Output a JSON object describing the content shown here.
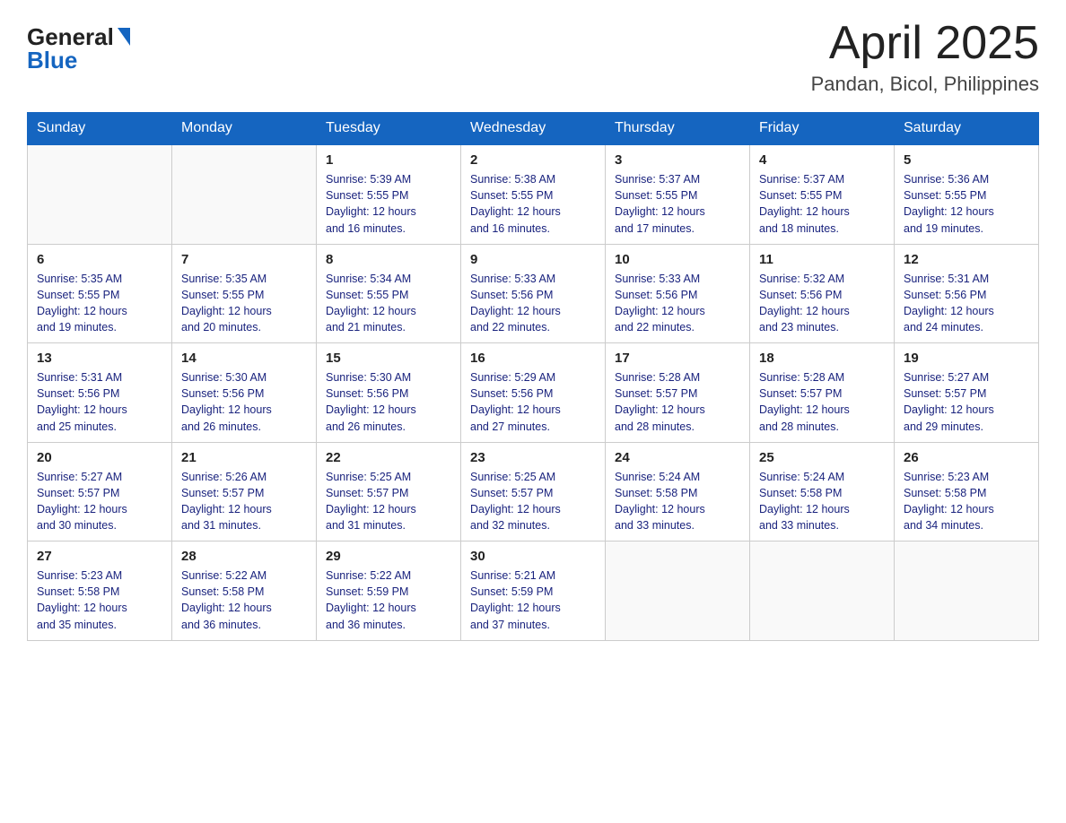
{
  "header": {
    "logo_general": "General",
    "logo_blue": "Blue",
    "month_title": "April 2025",
    "location": "Pandan, Bicol, Philippines"
  },
  "days_of_week": [
    "Sunday",
    "Monday",
    "Tuesday",
    "Wednesday",
    "Thursday",
    "Friday",
    "Saturday"
  ],
  "weeks": [
    [
      {
        "day": "",
        "info": ""
      },
      {
        "day": "",
        "info": ""
      },
      {
        "day": "1",
        "info": "Sunrise: 5:39 AM\nSunset: 5:55 PM\nDaylight: 12 hours\nand 16 minutes."
      },
      {
        "day": "2",
        "info": "Sunrise: 5:38 AM\nSunset: 5:55 PM\nDaylight: 12 hours\nand 16 minutes."
      },
      {
        "day": "3",
        "info": "Sunrise: 5:37 AM\nSunset: 5:55 PM\nDaylight: 12 hours\nand 17 minutes."
      },
      {
        "day": "4",
        "info": "Sunrise: 5:37 AM\nSunset: 5:55 PM\nDaylight: 12 hours\nand 18 minutes."
      },
      {
        "day": "5",
        "info": "Sunrise: 5:36 AM\nSunset: 5:55 PM\nDaylight: 12 hours\nand 19 minutes."
      }
    ],
    [
      {
        "day": "6",
        "info": "Sunrise: 5:35 AM\nSunset: 5:55 PM\nDaylight: 12 hours\nand 19 minutes."
      },
      {
        "day": "7",
        "info": "Sunrise: 5:35 AM\nSunset: 5:55 PM\nDaylight: 12 hours\nand 20 minutes."
      },
      {
        "day": "8",
        "info": "Sunrise: 5:34 AM\nSunset: 5:55 PM\nDaylight: 12 hours\nand 21 minutes."
      },
      {
        "day": "9",
        "info": "Sunrise: 5:33 AM\nSunset: 5:56 PM\nDaylight: 12 hours\nand 22 minutes."
      },
      {
        "day": "10",
        "info": "Sunrise: 5:33 AM\nSunset: 5:56 PM\nDaylight: 12 hours\nand 22 minutes."
      },
      {
        "day": "11",
        "info": "Sunrise: 5:32 AM\nSunset: 5:56 PM\nDaylight: 12 hours\nand 23 minutes."
      },
      {
        "day": "12",
        "info": "Sunrise: 5:31 AM\nSunset: 5:56 PM\nDaylight: 12 hours\nand 24 minutes."
      }
    ],
    [
      {
        "day": "13",
        "info": "Sunrise: 5:31 AM\nSunset: 5:56 PM\nDaylight: 12 hours\nand 25 minutes."
      },
      {
        "day": "14",
        "info": "Sunrise: 5:30 AM\nSunset: 5:56 PM\nDaylight: 12 hours\nand 26 minutes."
      },
      {
        "day": "15",
        "info": "Sunrise: 5:30 AM\nSunset: 5:56 PM\nDaylight: 12 hours\nand 26 minutes."
      },
      {
        "day": "16",
        "info": "Sunrise: 5:29 AM\nSunset: 5:56 PM\nDaylight: 12 hours\nand 27 minutes."
      },
      {
        "day": "17",
        "info": "Sunrise: 5:28 AM\nSunset: 5:57 PM\nDaylight: 12 hours\nand 28 minutes."
      },
      {
        "day": "18",
        "info": "Sunrise: 5:28 AM\nSunset: 5:57 PM\nDaylight: 12 hours\nand 28 minutes."
      },
      {
        "day": "19",
        "info": "Sunrise: 5:27 AM\nSunset: 5:57 PM\nDaylight: 12 hours\nand 29 minutes."
      }
    ],
    [
      {
        "day": "20",
        "info": "Sunrise: 5:27 AM\nSunset: 5:57 PM\nDaylight: 12 hours\nand 30 minutes."
      },
      {
        "day": "21",
        "info": "Sunrise: 5:26 AM\nSunset: 5:57 PM\nDaylight: 12 hours\nand 31 minutes."
      },
      {
        "day": "22",
        "info": "Sunrise: 5:25 AM\nSunset: 5:57 PM\nDaylight: 12 hours\nand 31 minutes."
      },
      {
        "day": "23",
        "info": "Sunrise: 5:25 AM\nSunset: 5:57 PM\nDaylight: 12 hours\nand 32 minutes."
      },
      {
        "day": "24",
        "info": "Sunrise: 5:24 AM\nSunset: 5:58 PM\nDaylight: 12 hours\nand 33 minutes."
      },
      {
        "day": "25",
        "info": "Sunrise: 5:24 AM\nSunset: 5:58 PM\nDaylight: 12 hours\nand 33 minutes."
      },
      {
        "day": "26",
        "info": "Sunrise: 5:23 AM\nSunset: 5:58 PM\nDaylight: 12 hours\nand 34 minutes."
      }
    ],
    [
      {
        "day": "27",
        "info": "Sunrise: 5:23 AM\nSunset: 5:58 PM\nDaylight: 12 hours\nand 35 minutes."
      },
      {
        "day": "28",
        "info": "Sunrise: 5:22 AM\nSunset: 5:58 PM\nDaylight: 12 hours\nand 36 minutes."
      },
      {
        "day": "29",
        "info": "Sunrise: 5:22 AM\nSunset: 5:59 PM\nDaylight: 12 hours\nand 36 minutes."
      },
      {
        "day": "30",
        "info": "Sunrise: 5:21 AM\nSunset: 5:59 PM\nDaylight: 12 hours\nand 37 minutes."
      },
      {
        "day": "",
        "info": ""
      },
      {
        "day": "",
        "info": ""
      },
      {
        "day": "",
        "info": ""
      }
    ]
  ]
}
